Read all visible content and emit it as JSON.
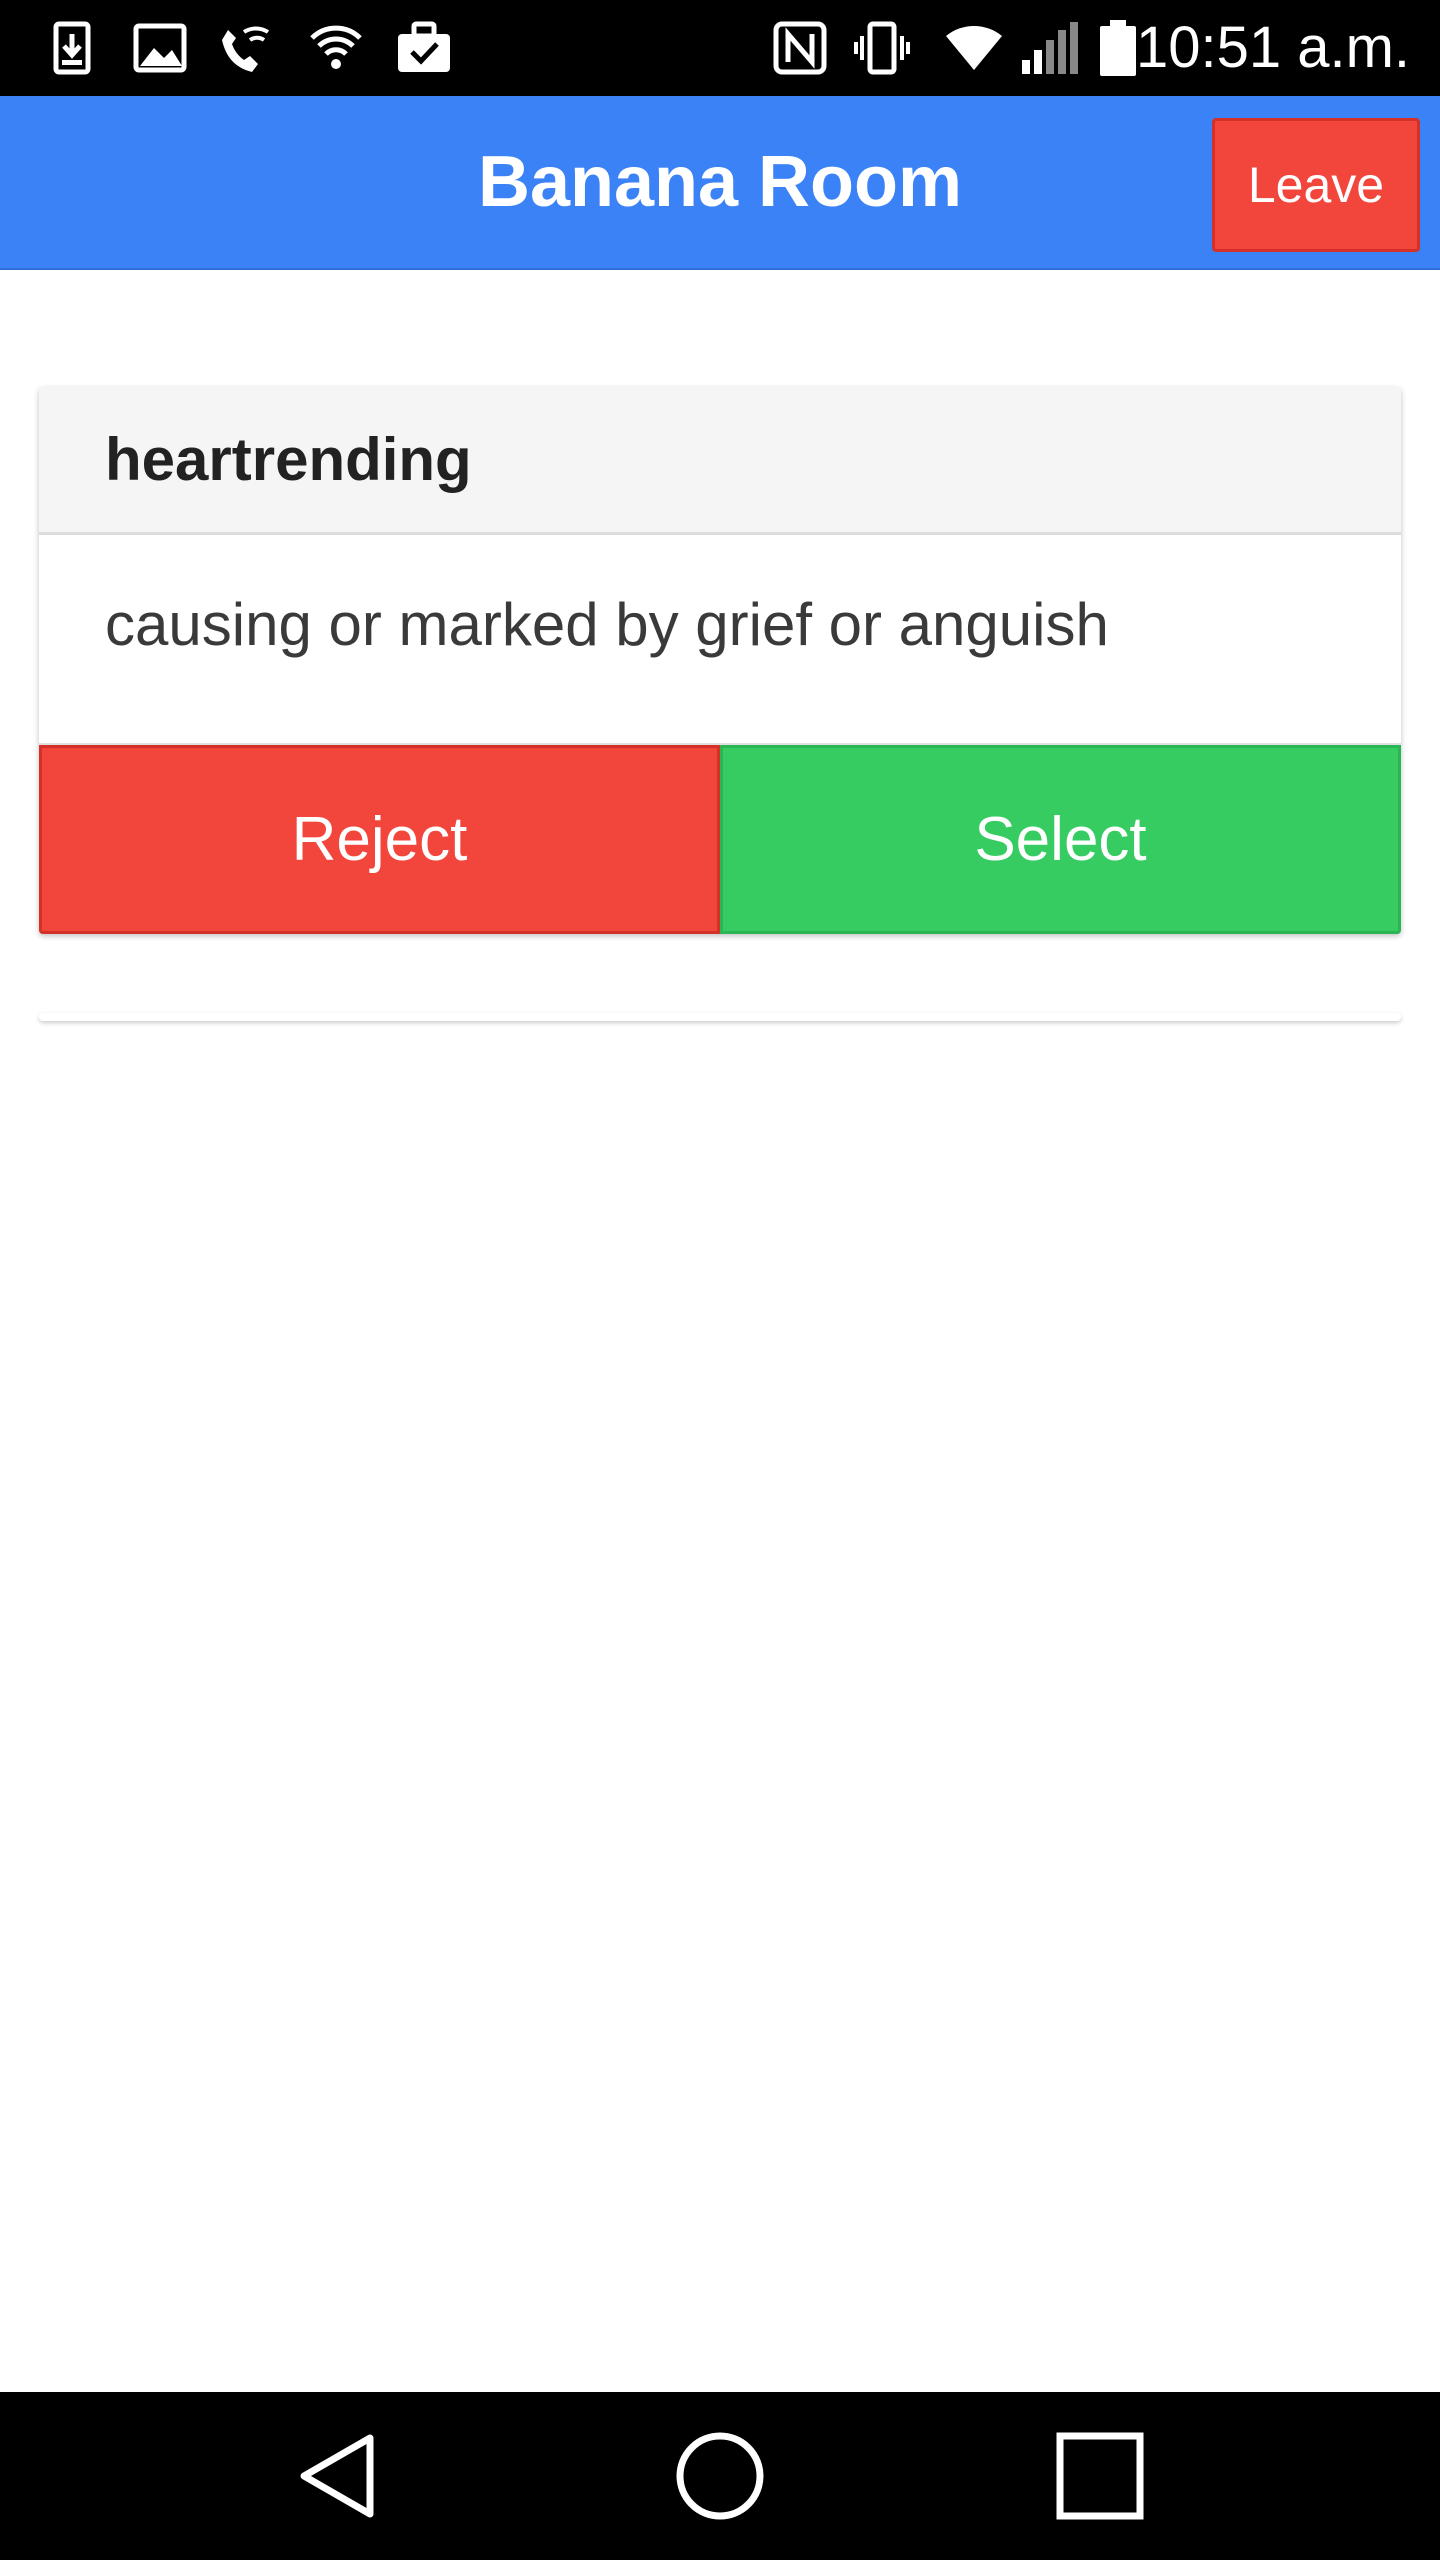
{
  "status_bar": {
    "time": "10:51 a.m.",
    "left_icons": [
      "download-icon",
      "image-icon",
      "wifi-call-icon",
      "wifi-security-icon",
      "briefcase-check-icon"
    ],
    "right_icons": [
      "nfc-icon",
      "vibrate-icon",
      "wifi-icon",
      "signal-icon",
      "battery-icon"
    ]
  },
  "app_bar": {
    "title": "Banana Room",
    "leave_label": "Leave"
  },
  "card": {
    "word": "heartrending",
    "definition": "causing or marked by grief or anguish",
    "reject_label": "Reject",
    "select_label": "Select"
  },
  "nav_bar": {
    "icons": [
      "back-icon",
      "home-icon",
      "recents-icon"
    ]
  },
  "colors": {
    "app_bar": "#3b82f6",
    "reject": "#f2463d",
    "select": "#36cc62",
    "header_bg": "#f5f5f5"
  }
}
